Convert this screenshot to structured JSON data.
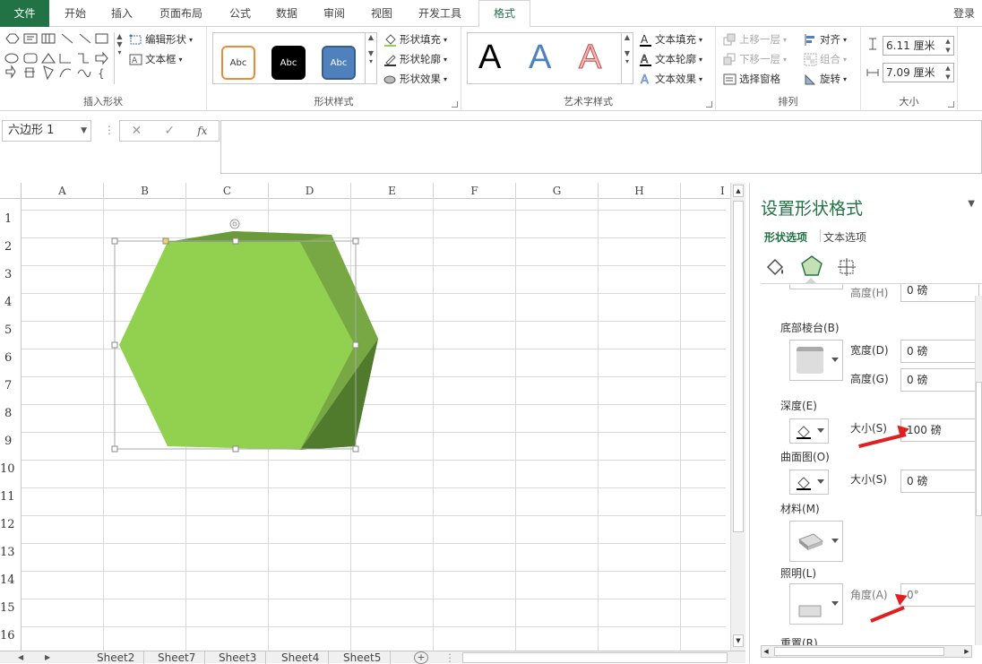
{
  "tabs": [
    "文件",
    "开始",
    "插入",
    "页面布局",
    "公式",
    "数据",
    "审阅",
    "视图",
    "开发工具",
    "格式"
  ],
  "login": "登录",
  "ribbon": {
    "insert_shapes": {
      "edit_shape": "编辑形状",
      "text_box": "文本框",
      "label": "插入形状"
    },
    "shape_styles": {
      "sample": "Abc",
      "fill": "形状填充",
      "outline": "形状轮廓",
      "effect": "形状效果",
      "label": "形状样式"
    },
    "wordart": {
      "letter": "A",
      "text_fill": "文本填充",
      "text_outline": "文本轮廓",
      "text_effect": "文本效果",
      "label": "艺术字样式"
    },
    "arrange": {
      "bring_forward": "上移一层",
      "send_backward": "下移一层",
      "selection_pane": "选择窗格",
      "align": "对齐",
      "group": "组合",
      "rotate": "旋转",
      "label": "排列"
    },
    "size": {
      "height": "6.11 厘米",
      "width": "7.09 厘米",
      "label": "大小"
    }
  },
  "formula_bar": {
    "name_box": "六边形 1",
    "fx": "fx"
  },
  "columns": [
    "A",
    "B",
    "C",
    "D",
    "E",
    "F",
    "G",
    "H",
    "I"
  ],
  "rows": [
    "1",
    "2",
    "3",
    "4",
    "5",
    "6",
    "7",
    "8",
    "9",
    "10",
    "11",
    "12",
    "13",
    "14",
    "15",
    "16"
  ],
  "sheets": [
    "Sheet2",
    "Sheet7",
    "Sheet3",
    "Sheet4",
    "Sheet5"
  ],
  "panel": {
    "title": "设置形状格式",
    "tab_shape": "形状选项",
    "tab_text": "文本选项",
    "top_height_label": "高度(H)",
    "top_height_value": "0 磅",
    "bottom_bevel": "底部棱台(B)",
    "bb_width_label": "宽度(D)",
    "bb_width_value": "0 磅",
    "bb_height_label": "高度(G)",
    "bb_height_value": "0 磅",
    "depth": "深度(E)",
    "depth_size_label": "大小(S)",
    "depth_size_value": "100 磅",
    "contour": "曲面图(O)",
    "contour_size_label": "大小(S)",
    "contour_size_value": "0 磅",
    "material": "材料(M)",
    "lighting": "照明(L)",
    "angle_label": "角度(A)",
    "angle_value": "0°",
    "reset": "重置(R)"
  },
  "colors": {
    "accent": "#217346",
    "shape_front": "#92d050",
    "shape_right": "#78a843",
    "shape_top": "#6b9a3a",
    "arrow": "#e02020"
  }
}
